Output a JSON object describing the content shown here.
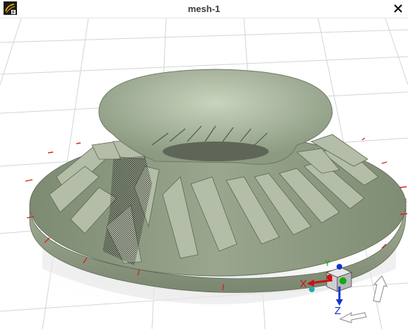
{
  "window": {
    "title": "mesh-1",
    "app_icon": "fluent-app-icon",
    "close_icon": "close-icon"
  },
  "viewport": {
    "model": "impeller-mesh",
    "background": "#ffffff",
    "model_color": "#8f9c84",
    "axis_triad": {
      "x_label": "X",
      "y_label": "Y",
      "z_label": "Z",
      "x_color": "#cc1111",
      "y_color": "#11aa11",
      "z_color": "#1133cc"
    }
  }
}
